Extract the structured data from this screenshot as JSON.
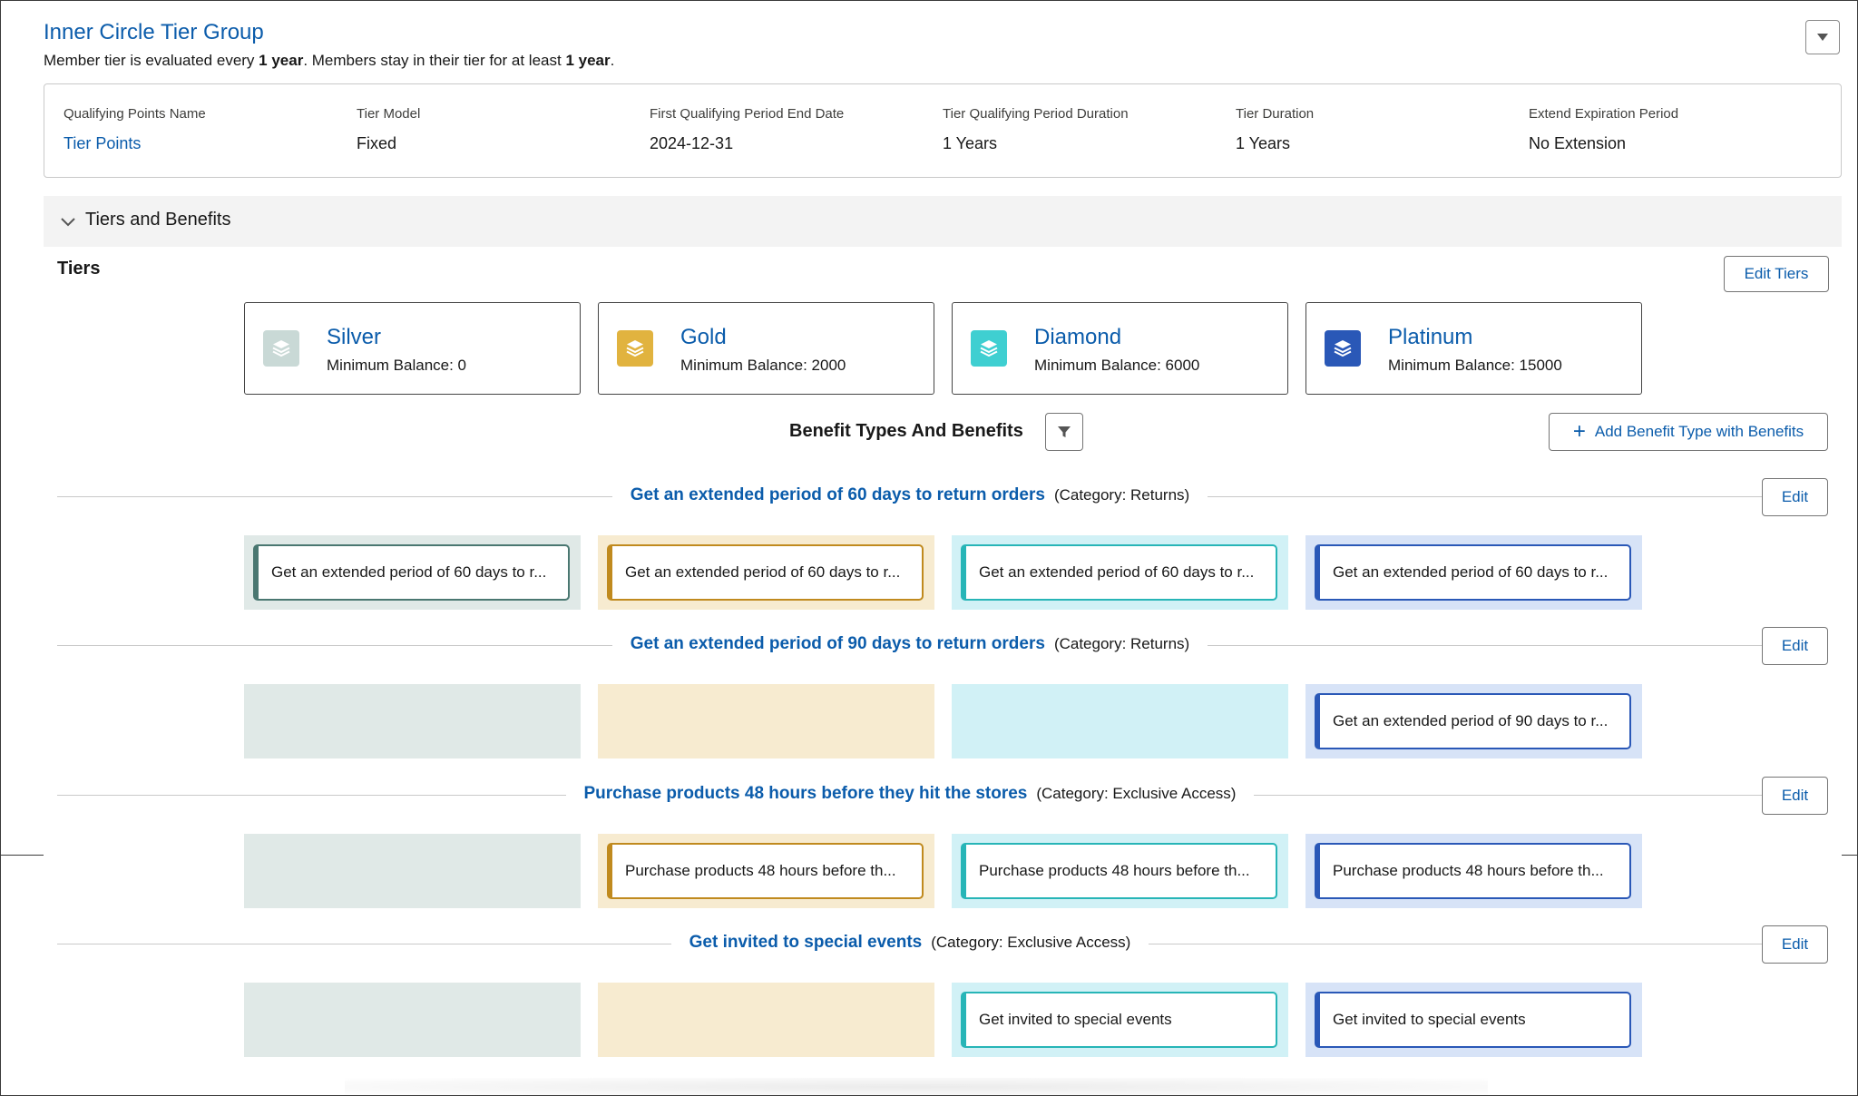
{
  "group": {
    "title": "Inner Circle Tier Group",
    "desc_part1": "Member tier is evaluated every ",
    "desc_bold1": "1 year",
    "desc_part2": ". Members stay in their tier for at least ",
    "desc_bold2": "1 year",
    "desc_part3": "."
  },
  "info": [
    {
      "label": "Qualifying Points Name",
      "value": "Tier Points"
    },
    {
      "label": "Tier Model",
      "value": "Fixed"
    },
    {
      "label": "First Qualifying Period End Date",
      "value": "2024-12-31"
    },
    {
      "label": "Tier Qualifying Period Duration",
      "value": "1 Years"
    },
    {
      "label": "Tier Duration",
      "value": "1 Years"
    },
    {
      "label": "Extend Expiration Period",
      "value": "No Extension"
    }
  ],
  "section": {
    "title": "Tiers and Benefits"
  },
  "tiers_heading": "Tiers",
  "edit_tiers_label": "Edit Tiers",
  "tiers": [
    {
      "name": "Silver",
      "min": "Minimum Balance: 0",
      "color": "#c9d9d6"
    },
    {
      "name": "Gold",
      "min": "Minimum Balance: 2000",
      "color": "#e1b33f"
    },
    {
      "name": "Diamond",
      "min": "Minimum Balance: 6000",
      "color": "#3fcfd1"
    },
    {
      "name": "Platinum",
      "min": "Minimum Balance: 15000",
      "color": "#2a58b7"
    }
  ],
  "benefits_heading": "Benefit Types And Benefits",
  "add_benefit_label": "Add Benefit Type with Benefits",
  "edit_label": "Edit",
  "benefit_types": [
    {
      "name": "Get an extended period of 60 days to return orders",
      "category": "(Category: Returns)",
      "cells": [
        "Get an extended period of 60 days to r...",
        "Get an extended period of 60 days to r...",
        "Get an extended period of 60 days to r...",
        "Get an extended period of 60 days to r..."
      ]
    },
    {
      "name": "Get an extended period of 90 days to return orders",
      "category": "(Category: Returns)",
      "cells": [
        "",
        "",
        "",
        "Get an extended period of 90 days to r..."
      ]
    },
    {
      "name": "Purchase products 48 hours before they hit the stores",
      "category": "(Category: Exclusive Access)",
      "cells": [
        "",
        "Purchase products 48 hours before th...",
        "Purchase products 48 hours before th...",
        "Purchase products 48 hours before th..."
      ]
    },
    {
      "name": "Get invited to special events",
      "category": "(Category: Exclusive Access)",
      "cells": [
        "",
        "",
        "Get invited to special events",
        "Get invited to special events"
      ]
    }
  ]
}
